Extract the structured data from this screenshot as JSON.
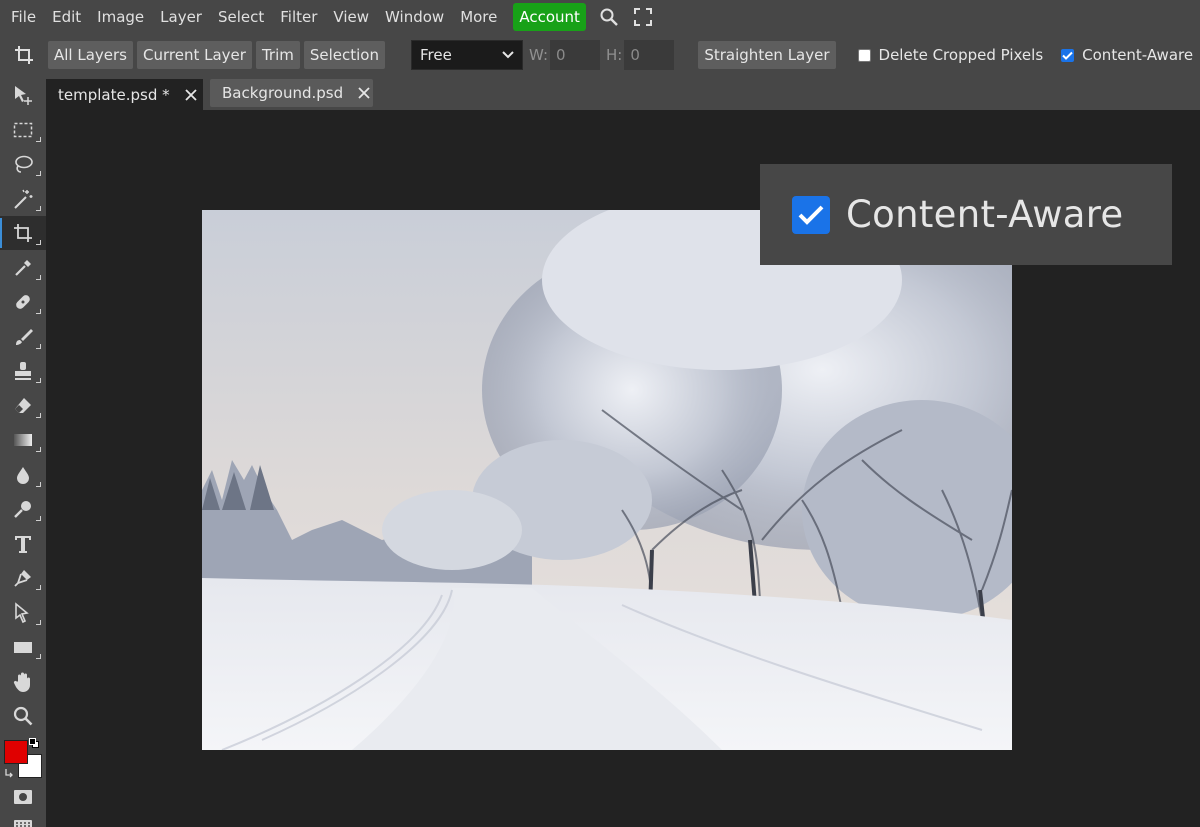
{
  "menu": {
    "items": [
      "File",
      "Edit",
      "Image",
      "Layer",
      "Select",
      "Filter",
      "View",
      "Window",
      "More"
    ],
    "account": "Account",
    "account_color": "#18a118"
  },
  "options": {
    "buttons": [
      "All Layers",
      "Current Layer",
      "Trim",
      "Selection"
    ],
    "ratio_value": "Free",
    "width_label": "W:",
    "width_value": "0",
    "height_label": "H:",
    "height_value": "0",
    "straighten": "Straighten Layer",
    "delete_cropped": {
      "label": "Delete Cropped Pixels",
      "checked": false
    },
    "content_aware": {
      "label": "Content-Aware",
      "checked": true
    }
  },
  "tabs": [
    {
      "label": "template.psd *",
      "active": true
    },
    {
      "label": "Background.psd",
      "active": false
    }
  ],
  "tools": [
    "move",
    "marquee",
    "lasso",
    "magic-wand",
    "crop",
    "eyedropper",
    "healing",
    "brush",
    "stamp",
    "eraser",
    "gradient",
    "blur",
    "dodge",
    "text",
    "pen",
    "path-select",
    "shape",
    "hand",
    "zoom"
  ],
  "active_tool": "crop",
  "colors": {
    "foreground": "#e00000",
    "background": "#ffffff",
    "accent": "#1a73e8"
  },
  "callout": {
    "label": "Content-Aware",
    "checked": true
  }
}
